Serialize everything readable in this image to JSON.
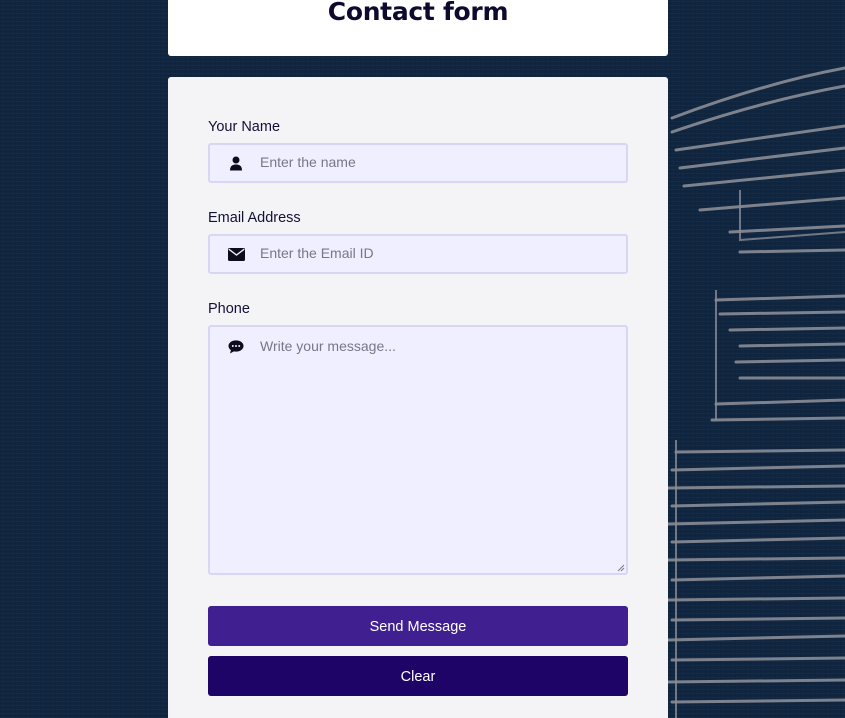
{
  "page": {
    "title": "Contact form"
  },
  "form": {
    "name": {
      "label": "Your Name",
      "placeholder": "Enter the name",
      "icon": "user-icon"
    },
    "email": {
      "label": "Email Address",
      "placeholder": "Enter the Email ID",
      "icon": "envelope-icon"
    },
    "message": {
      "label": "Phone",
      "placeholder": "Write your message...",
      "icon": "chat-bubble-icon"
    },
    "buttons": {
      "send_label": "Send Message",
      "clear_label": "Clear"
    }
  },
  "colors": {
    "background": "#102640",
    "card": "#f4f4f6",
    "field_fill": "#efefff",
    "field_border": "#d6d6f6",
    "send_button": "#402091",
    "clear_button": "#1d0466",
    "title_text": "#0d0a2e"
  }
}
